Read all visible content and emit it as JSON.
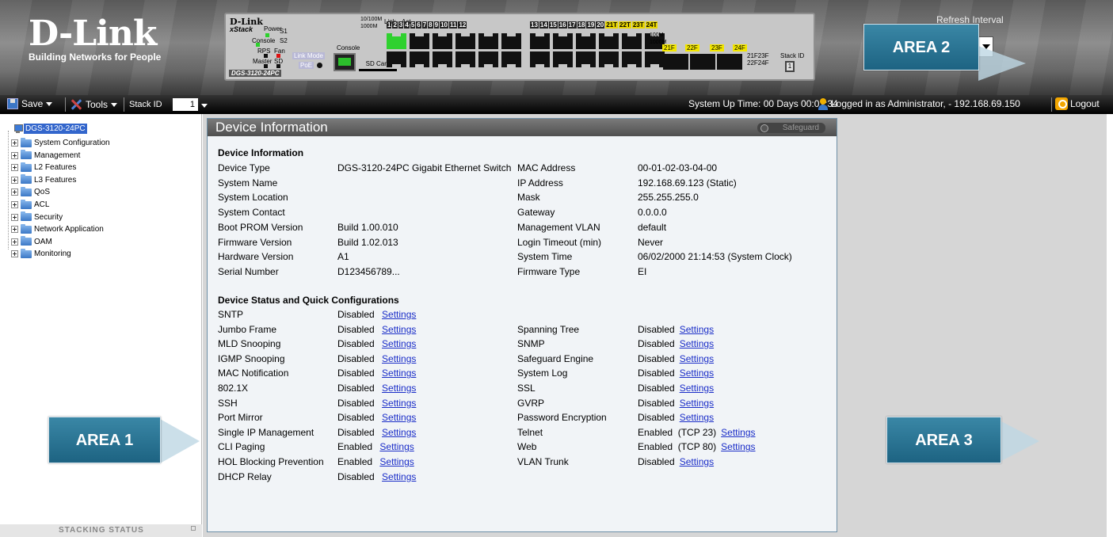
{
  "header": {
    "logo_text": "D-Link",
    "logo_tagline": "Building Networks for People",
    "refresh_label": "Refresh Interval",
    "panel": {
      "brand": "D-Link",
      "series": "xStack",
      "model": "DGS-3120-24PC",
      "legend_speed": "10/100M\n1000M",
      "legend_link": "Link",
      "legend_act": "Act",
      "leds": [
        "Power",
        "Console",
        "RPS",
        "Fan",
        "Master",
        "SD"
      ],
      "s_labels": [
        "S1",
        "S2"
      ],
      "link_mode": "Link Mode",
      "poe": "PoE",
      "console_label": "Console",
      "sd_card": "SD Card",
      "port_pairs_a": [
        "1",
        "2",
        "3",
        "4",
        "5",
        "6",
        "7",
        "8",
        "9",
        "10",
        "11",
        "12"
      ],
      "port_pairs_b": [
        "13",
        "14",
        "15",
        "16",
        "17",
        "18",
        "19",
        "20"
      ],
      "port_combo": [
        "21T",
        "22T",
        "23T",
        "24T"
      ],
      "speed_label": "100M\n1000M",
      "sfp_labels": [
        "21F",
        "22F",
        "23F",
        "24F"
      ],
      "sfp_right": "21F23F\n22F24F",
      "stack_id_label": "Stack ID",
      "stack_id_value": "1"
    }
  },
  "areas": {
    "area1": "AREA 1",
    "area2": "AREA 2",
    "area3": "AREA 3"
  },
  "toolbar": {
    "save": "Save",
    "tools": "Tools",
    "stack_id": "Stack ID",
    "stack_value": "1",
    "uptime": "System Up Time: 00 Days 00:01:34",
    "logged_in": "Logged in as Administrator, - 192.168.69.150",
    "logout": "Logout"
  },
  "tree": {
    "root": "DGS-3120-24PC",
    "items": [
      "System Configuration",
      "Management",
      "L2 Features",
      "L3 Features",
      "QoS",
      "ACL",
      "Security",
      "Network Application",
      "OAM",
      "Monitoring"
    ],
    "stacking": "Stacking Status"
  },
  "device": {
    "window_title": "Device Information",
    "safeguard": "Safeguard",
    "section1": "Device Information",
    "left_rows": [
      {
        "label": "Device Type",
        "value": "DGS-3120-24PC Gigabit Ethernet Switch"
      },
      {
        "label": "System Name",
        "value": ""
      },
      {
        "label": "System Location",
        "value": ""
      },
      {
        "label": "System Contact",
        "value": ""
      },
      {
        "label": "Boot PROM Version",
        "value": "Build 1.00.010"
      },
      {
        "label": "Firmware Version",
        "value": "Build 1.02.013"
      },
      {
        "label": "Hardware Version",
        "value": "A1"
      },
      {
        "label": "Serial Number",
        "value": "D123456789..."
      }
    ],
    "right_rows": [
      {
        "label": "MAC Address",
        "value": "00-01-02-03-04-00"
      },
      {
        "label": "IP Address",
        "value": "192.168.69.123 (Static)"
      },
      {
        "label": "Mask",
        "value": "255.255.255.0"
      },
      {
        "label": "Gateway",
        "value": "0.0.0.0"
      },
      {
        "label": "Management VLAN",
        "value": "default"
      },
      {
        "label": "Login Timeout (min)",
        "value": "Never"
      },
      {
        "label": "System Time",
        "value": "06/02/2000 21:14:53 (System Clock)"
      },
      {
        "label": "Firmware Type",
        "value": "EI"
      }
    ],
    "section2": "Device Status and Quick Configurations",
    "settings_label": "Settings",
    "status_left": [
      {
        "label": "SNTP",
        "status": "Disabled"
      },
      {
        "label": "Jumbo Frame",
        "status": "Disabled"
      },
      {
        "label": "MLD Snooping",
        "status": "Disabled"
      },
      {
        "label": "IGMP Snooping",
        "status": "Disabled"
      },
      {
        "label": "MAC Notification",
        "status": "Disabled"
      },
      {
        "label": "802.1X",
        "status": "Disabled"
      },
      {
        "label": "SSH",
        "status": "Disabled"
      },
      {
        "label": "Port Mirror",
        "status": "Disabled"
      },
      {
        "label": "Single IP Management",
        "status": "Disabled"
      },
      {
        "label": "CLI Paging",
        "status": "Enabled"
      },
      {
        "label": "HOL Blocking Prevention",
        "status": "Enabled"
      },
      {
        "label": "DHCP Relay",
        "status": "Disabled"
      }
    ],
    "status_right": [
      {
        "label": "Spanning Tree",
        "status": "Disabled"
      },
      {
        "label": "SNMP",
        "status": "Disabled"
      },
      {
        "label": "Safeguard Engine",
        "status": "Disabled"
      },
      {
        "label": "System Log",
        "status": "Disabled"
      },
      {
        "label": "SSL",
        "status": "Disabled"
      },
      {
        "label": "GVRP",
        "status": "Disabled"
      },
      {
        "label": "Password Encryption",
        "status": "Disabled"
      },
      {
        "label": "Telnet",
        "status": "Enabled  (TCP 23)"
      },
      {
        "label": "Web",
        "status": "Enabled  (TCP 80)"
      },
      {
        "label": "VLAN Trunk",
        "status": "Disabled"
      }
    ]
  },
  "colors": {
    "link": "#1a2dc8",
    "area_callout": "#2a7597",
    "toolbar": "#000000",
    "selection": "#3366cc"
  }
}
